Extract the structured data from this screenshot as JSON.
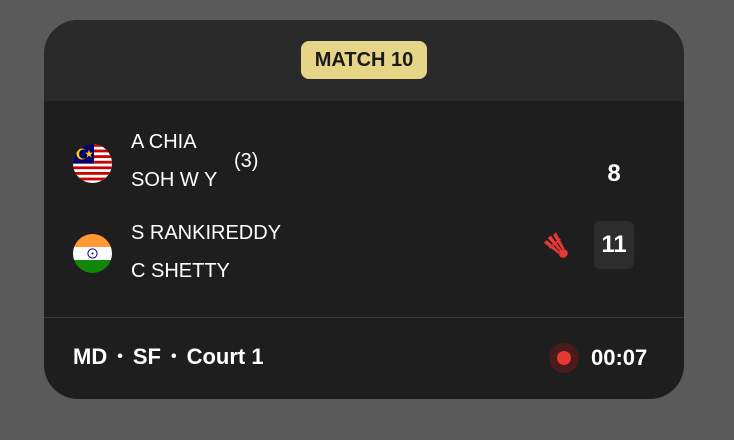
{
  "match": {
    "label": "MATCH 10",
    "badge_color": "#e6d487"
  },
  "teams": [
    {
      "country_flag_icon": "malaysia-flag-icon",
      "players": [
        "A CHIA",
        "SOH W Y"
      ],
      "seed": "(3)",
      "score": "8",
      "serving": false
    },
    {
      "country_flag_icon": "india-flag-icon",
      "players": [
        "S RANKIREDDY",
        "C SHETTY"
      ],
      "seed": "",
      "score": "11",
      "serving": true,
      "serve_icon": "shuttlecock-icon",
      "serve_icon_color": "#e53935"
    }
  ],
  "footer": {
    "event": "MD",
    "round": "SF",
    "court": "Court 1",
    "separator": "•",
    "live_icon": "live-record-icon",
    "live_color": "#e53935",
    "time": "00:07"
  }
}
